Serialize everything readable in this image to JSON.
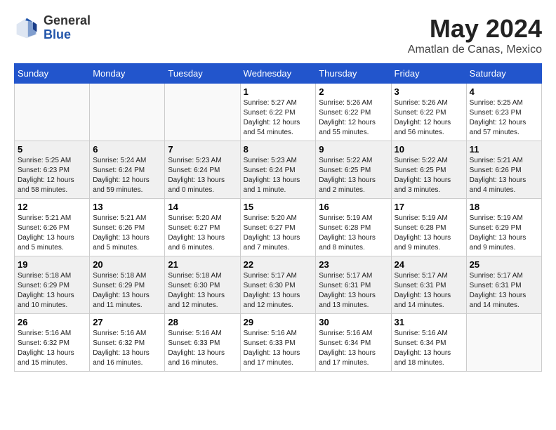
{
  "logo": {
    "line1": "General",
    "line2": "Blue"
  },
  "title": "May 2024",
  "location": "Amatlan de Canas, Mexico",
  "days_of_week": [
    "Sunday",
    "Monday",
    "Tuesday",
    "Wednesday",
    "Thursday",
    "Friday",
    "Saturday"
  ],
  "weeks": [
    [
      {
        "num": "",
        "info": ""
      },
      {
        "num": "",
        "info": ""
      },
      {
        "num": "",
        "info": ""
      },
      {
        "num": "1",
        "info": "Sunrise: 5:27 AM\nSunset: 6:22 PM\nDaylight: 12 hours\nand 54 minutes."
      },
      {
        "num": "2",
        "info": "Sunrise: 5:26 AM\nSunset: 6:22 PM\nDaylight: 12 hours\nand 55 minutes."
      },
      {
        "num": "3",
        "info": "Sunrise: 5:26 AM\nSunset: 6:22 PM\nDaylight: 12 hours\nand 56 minutes."
      },
      {
        "num": "4",
        "info": "Sunrise: 5:25 AM\nSunset: 6:23 PM\nDaylight: 12 hours\nand 57 minutes."
      }
    ],
    [
      {
        "num": "5",
        "info": "Sunrise: 5:25 AM\nSunset: 6:23 PM\nDaylight: 12 hours\nand 58 minutes."
      },
      {
        "num": "6",
        "info": "Sunrise: 5:24 AM\nSunset: 6:24 PM\nDaylight: 12 hours\nand 59 minutes."
      },
      {
        "num": "7",
        "info": "Sunrise: 5:23 AM\nSunset: 6:24 PM\nDaylight: 13 hours\nand 0 minutes."
      },
      {
        "num": "8",
        "info": "Sunrise: 5:23 AM\nSunset: 6:24 PM\nDaylight: 13 hours\nand 1 minute."
      },
      {
        "num": "9",
        "info": "Sunrise: 5:22 AM\nSunset: 6:25 PM\nDaylight: 13 hours\nand 2 minutes."
      },
      {
        "num": "10",
        "info": "Sunrise: 5:22 AM\nSunset: 6:25 PM\nDaylight: 13 hours\nand 3 minutes."
      },
      {
        "num": "11",
        "info": "Sunrise: 5:21 AM\nSunset: 6:26 PM\nDaylight: 13 hours\nand 4 minutes."
      }
    ],
    [
      {
        "num": "12",
        "info": "Sunrise: 5:21 AM\nSunset: 6:26 PM\nDaylight: 13 hours\nand 5 minutes."
      },
      {
        "num": "13",
        "info": "Sunrise: 5:21 AM\nSunset: 6:26 PM\nDaylight: 13 hours\nand 5 minutes."
      },
      {
        "num": "14",
        "info": "Sunrise: 5:20 AM\nSunset: 6:27 PM\nDaylight: 13 hours\nand 6 minutes."
      },
      {
        "num": "15",
        "info": "Sunrise: 5:20 AM\nSunset: 6:27 PM\nDaylight: 13 hours\nand 7 minutes."
      },
      {
        "num": "16",
        "info": "Sunrise: 5:19 AM\nSunset: 6:28 PM\nDaylight: 13 hours\nand 8 minutes."
      },
      {
        "num": "17",
        "info": "Sunrise: 5:19 AM\nSunset: 6:28 PM\nDaylight: 13 hours\nand 9 minutes."
      },
      {
        "num": "18",
        "info": "Sunrise: 5:19 AM\nSunset: 6:29 PM\nDaylight: 13 hours\nand 9 minutes."
      }
    ],
    [
      {
        "num": "19",
        "info": "Sunrise: 5:18 AM\nSunset: 6:29 PM\nDaylight: 13 hours\nand 10 minutes."
      },
      {
        "num": "20",
        "info": "Sunrise: 5:18 AM\nSunset: 6:29 PM\nDaylight: 13 hours\nand 11 minutes."
      },
      {
        "num": "21",
        "info": "Sunrise: 5:18 AM\nSunset: 6:30 PM\nDaylight: 13 hours\nand 12 minutes."
      },
      {
        "num": "22",
        "info": "Sunrise: 5:17 AM\nSunset: 6:30 PM\nDaylight: 13 hours\nand 12 minutes."
      },
      {
        "num": "23",
        "info": "Sunrise: 5:17 AM\nSunset: 6:31 PM\nDaylight: 13 hours\nand 13 minutes."
      },
      {
        "num": "24",
        "info": "Sunrise: 5:17 AM\nSunset: 6:31 PM\nDaylight: 13 hours\nand 14 minutes."
      },
      {
        "num": "25",
        "info": "Sunrise: 5:17 AM\nSunset: 6:31 PM\nDaylight: 13 hours\nand 14 minutes."
      }
    ],
    [
      {
        "num": "26",
        "info": "Sunrise: 5:16 AM\nSunset: 6:32 PM\nDaylight: 13 hours\nand 15 minutes."
      },
      {
        "num": "27",
        "info": "Sunrise: 5:16 AM\nSunset: 6:32 PM\nDaylight: 13 hours\nand 16 minutes."
      },
      {
        "num": "28",
        "info": "Sunrise: 5:16 AM\nSunset: 6:33 PM\nDaylight: 13 hours\nand 16 minutes."
      },
      {
        "num": "29",
        "info": "Sunrise: 5:16 AM\nSunset: 6:33 PM\nDaylight: 13 hours\nand 17 minutes."
      },
      {
        "num": "30",
        "info": "Sunrise: 5:16 AM\nSunset: 6:34 PM\nDaylight: 13 hours\nand 17 minutes."
      },
      {
        "num": "31",
        "info": "Sunrise: 5:16 AM\nSunset: 6:34 PM\nDaylight: 13 hours\nand 18 minutes."
      },
      {
        "num": "",
        "info": ""
      }
    ]
  ]
}
